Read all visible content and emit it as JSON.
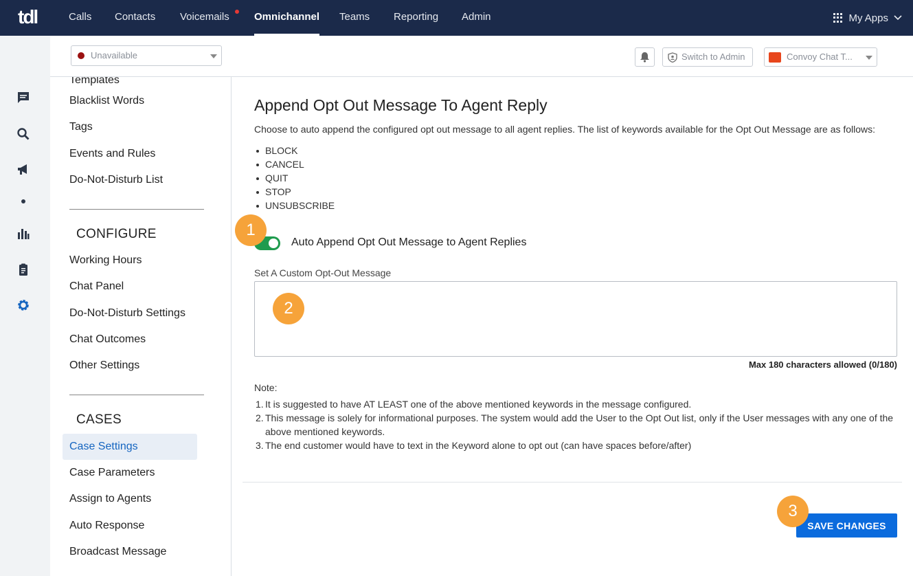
{
  "topnav": {
    "logo": "tdl",
    "items": [
      "Calls",
      "Contacts",
      "Voicemails",
      "Omnichannel",
      "Teams",
      "Reporting",
      "Admin"
    ],
    "active": "Omnichannel",
    "my_apps": "My Apps"
  },
  "subheader": {
    "status": "Unavailable",
    "switch_admin": "Switch to Admin",
    "chat_select": "Convoy Chat T..."
  },
  "menu": {
    "partial_top": "Templates",
    "group1": [
      "Blacklist Words",
      "Tags",
      "Events and Rules",
      "Do-Not-Disturb List"
    ],
    "configure_heading": "CONFIGURE",
    "configure": [
      "Working Hours",
      "Chat Panel",
      "Do-Not-Disturb Settings",
      "Chat Outcomes",
      "Other Settings"
    ],
    "cases_heading": "CASES",
    "cases": [
      "Case Settings",
      "Case Parameters",
      "Assign to Agents",
      "Auto Response",
      "Broadcast Message"
    ],
    "active": "Case Settings"
  },
  "content": {
    "title": "Append Opt Out Message To Agent Reply",
    "description": "Choose to auto append the configured opt out message to all agent replies. The list of keywords available for the Opt Out Message are as follows:",
    "keywords": [
      "BLOCK",
      "CANCEL",
      "QUIT",
      "STOP",
      "UNSUBSCRIBE"
    ],
    "toggle_label": "Auto Append Opt Out Message to Agent Replies",
    "toggle_on": true,
    "field_label": "Set A Custom Opt-Out Message",
    "textarea_value": "",
    "counter": "Max 180 characters allowed (0/180)",
    "note_label": "Note:",
    "notes": [
      "It is suggested to have AT LEAST one of the above mentioned keywords in the message configured.",
      "This message is solely for informational purposes. The system would add the User to the Opt Out list, only if the User messages with any one of the above mentioned keywords.",
      "The end customer would have to text in the Keyword alone to opt out (can have spaces before/after)"
    ],
    "save_label": "SAVE CHANGES"
  },
  "callouts": [
    "1",
    "2",
    "3"
  ],
  "colors": {
    "nav_bg": "#1b2a4a",
    "accent": "#0b6bdd",
    "toggle": "#1f9b4e",
    "callout": "#f6a33a"
  }
}
